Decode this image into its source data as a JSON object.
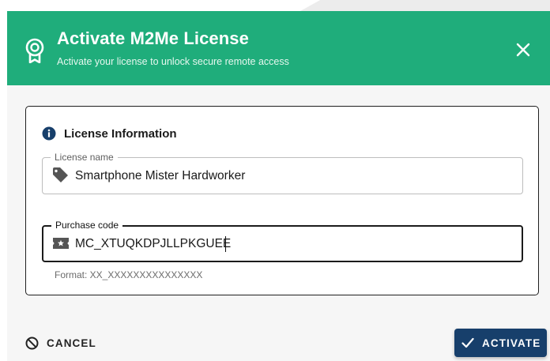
{
  "dialog": {
    "title": "Activate M2Me License",
    "subtitle": "Activate your license to unlock secure remote access",
    "accent_color": "#1fad7b",
    "header_icon": "award-ribbon-icon",
    "close_icon": "close-icon"
  },
  "license_section": {
    "title": "License Information",
    "icon": "info-icon",
    "license_name": {
      "label": "License name",
      "value": "Smartphone Mister Hardworker",
      "icon": "tag-icon"
    },
    "purchase_code": {
      "label": "Purchase code",
      "value": "MC_XTUQKDPJLLPKGUEE",
      "icon": "ticket-icon",
      "hint": "Format: XX_XXXXXXXXXXXXXXX",
      "focused": true
    }
  },
  "footer": {
    "cancel_label": "CANCEL",
    "cancel_icon": "cancel-icon",
    "activate_label": "ACTIVATE",
    "activate_icon": "checkmark-icon",
    "primary_color": "#173f6b"
  }
}
